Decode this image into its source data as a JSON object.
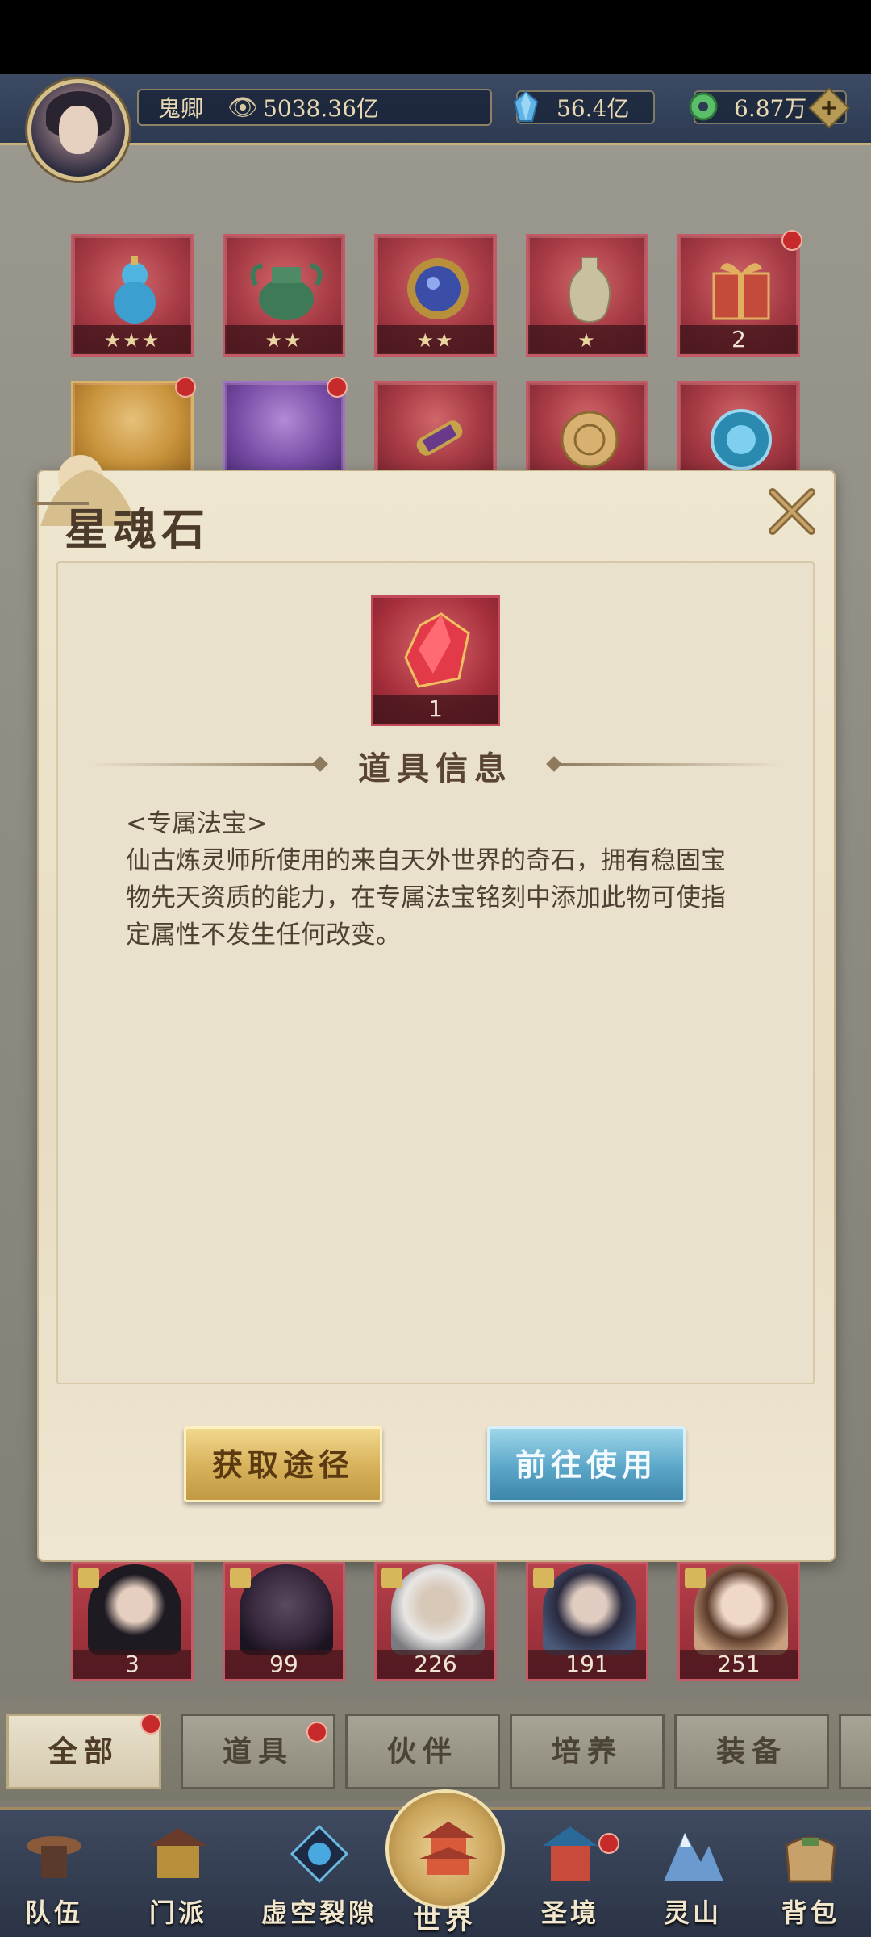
{
  "player": {
    "name": "鬼卿",
    "power": "5038.36亿",
    "resource1": "56.4亿",
    "resource2": "6.87万",
    "plus": "+"
  },
  "grid_row1": [
    {
      "stars": "★★★",
      "icon": "gourd-icon"
    },
    {
      "stars": "★★",
      "icon": "cauldron-icon"
    },
    {
      "stars": "★★",
      "icon": "mirror-icon"
    },
    {
      "stars": "★",
      "icon": "vase-icon"
    },
    {
      "count": "2",
      "icon": "giftbox-icon"
    }
  ],
  "dialog": {
    "title": "星魂石",
    "item_count": "1",
    "section_title": "道具信息",
    "tag": "<专属法宝>",
    "description": "仙古炼灵师所使用的来自天外世界的奇石，拥有稳固宝物先天资质的能力，在专属法宝铭刻中添加此物可使指定属性不发生任何改变。",
    "btn_obtain": "获取途径",
    "btn_use": "前往使用"
  },
  "partners": [
    {
      "count": "3"
    },
    {
      "count": "99"
    },
    {
      "count": "226"
    },
    {
      "count": "191"
    },
    {
      "count": "251"
    }
  ],
  "tabs": [
    "全部",
    "道具",
    "伙伴",
    "培养",
    "装备"
  ],
  "nav": {
    "team": "队伍",
    "sect": "门派",
    "rift": "虚空裂隙",
    "world": "世界",
    "realm": "圣境",
    "mountain": "灵山",
    "bag": "背包"
  },
  "colors": {
    "accent_gold": "#d7b05a",
    "accent_blue": "#5aa6c8",
    "badge_red": "#c72a2a"
  }
}
